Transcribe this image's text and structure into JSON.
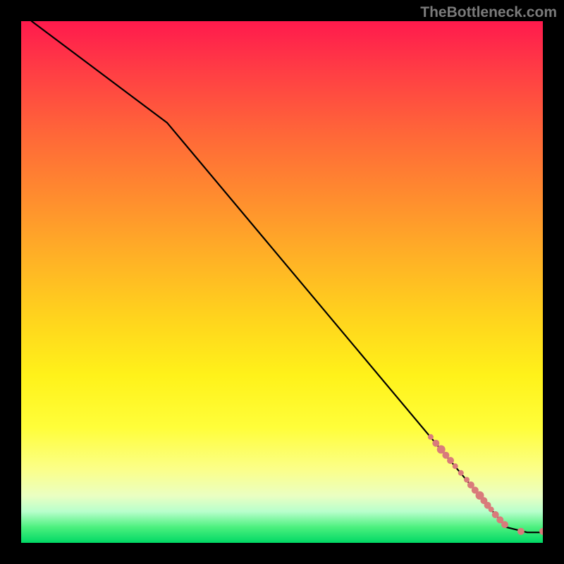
{
  "watermark_text": "TheBottleneck.com",
  "colors": {
    "line": "#000000",
    "marker_fill": "#d97b7b",
    "marker_stroke": "#d97b7b",
    "background_black": "#000000"
  },
  "chart_data": {
    "type": "line",
    "title": "",
    "xlabel": "",
    "ylabel": "",
    "xlim": [
      0,
      100
    ],
    "ylim": [
      0,
      100
    ],
    "grid": false,
    "legend": false,
    "line_points": [
      {
        "x": 2,
        "y": 100
      },
      {
        "x": 28,
        "y": 80.5
      },
      {
        "x": 90,
        "y": 6.5
      },
      {
        "x": 93,
        "y": 3
      },
      {
        "x": 97,
        "y": 2
      },
      {
        "x": 100,
        "y": 2
      }
    ],
    "markers": [
      {
        "x": 78.5,
        "y": 20.3,
        "r": 4
      },
      {
        "x": 79.5,
        "y": 19.1,
        "r": 5
      },
      {
        "x": 80.5,
        "y": 17.9,
        "r": 6
      },
      {
        "x": 81.4,
        "y": 16.8,
        "r": 5
      },
      {
        "x": 82.3,
        "y": 15.8,
        "r": 5
      },
      {
        "x": 83.2,
        "y": 14.7,
        "r": 4
      },
      {
        "x": 84.3,
        "y": 13.4,
        "r": 4
      },
      {
        "x": 85.4,
        "y": 12.1,
        "r": 4
      },
      {
        "x": 86.2,
        "y": 11.1,
        "r": 5
      },
      {
        "x": 87.0,
        "y": 10.1,
        "r": 5
      },
      {
        "x": 87.9,
        "y": 9.1,
        "r": 6
      },
      {
        "x": 88.7,
        "y": 8.1,
        "r": 5
      },
      {
        "x": 89.4,
        "y": 7.2,
        "r": 5
      },
      {
        "x": 90.1,
        "y": 6.4,
        "r": 4
      },
      {
        "x": 90.9,
        "y": 5.4,
        "r": 5
      },
      {
        "x": 91.8,
        "y": 4.4,
        "r": 5
      },
      {
        "x": 92.7,
        "y": 3.5,
        "r": 5
      },
      {
        "x": 95.8,
        "y": 2.2,
        "r": 5
      },
      {
        "x": 100.0,
        "y": 2.2,
        "r": 5
      }
    ]
  }
}
